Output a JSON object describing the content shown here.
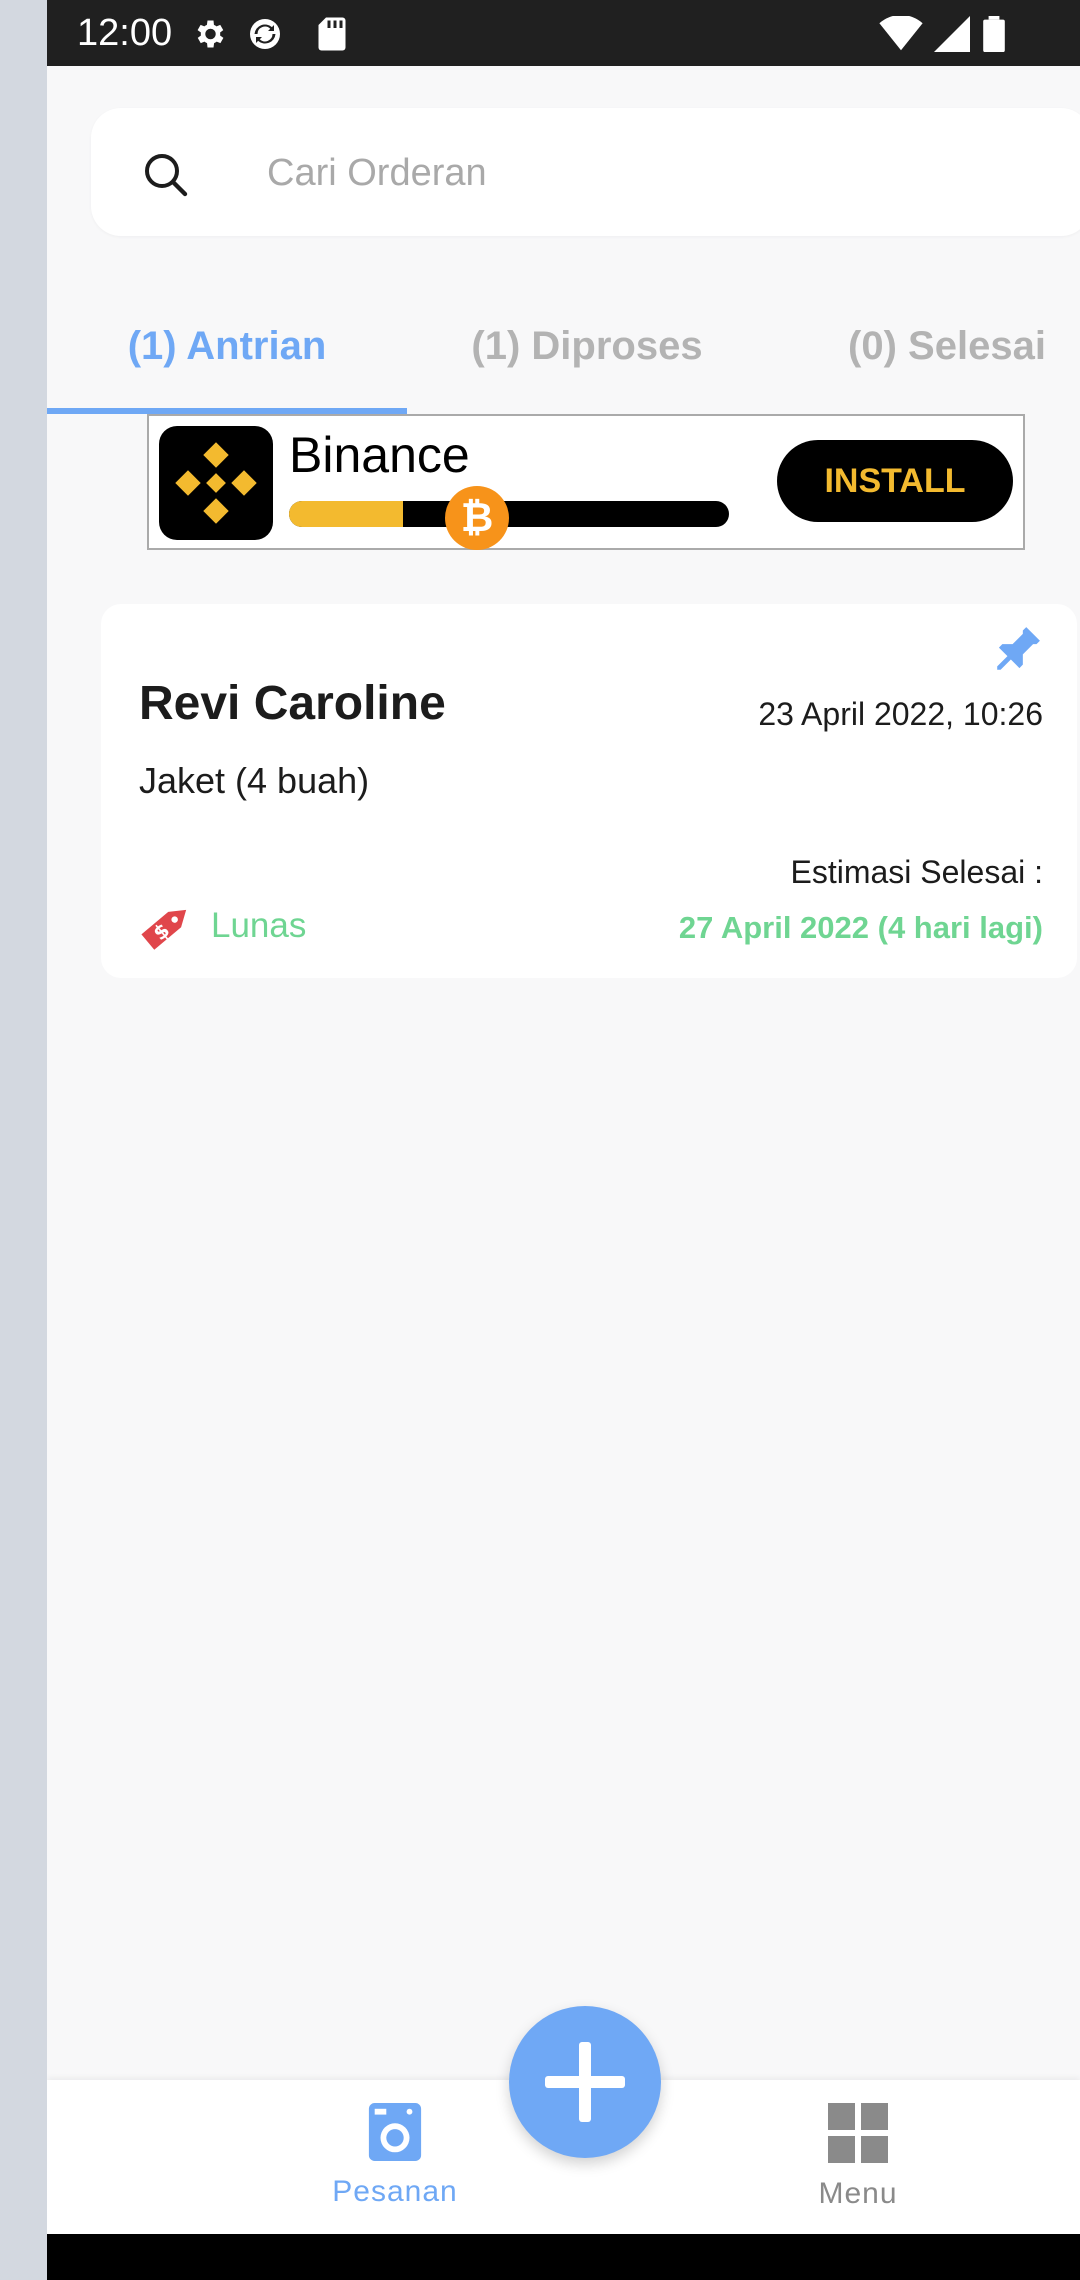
{
  "status_bar": {
    "time": "12:00"
  },
  "search": {
    "placeholder": "Cari Orderan"
  },
  "tabs": [
    {
      "label": "(1) Antrian",
      "active": true
    },
    {
      "label": "(1) Diproses",
      "active": false
    },
    {
      "label": "(0) Selesai",
      "active": false
    }
  ],
  "ad": {
    "title": "Binance",
    "button": "INSTALL",
    "coin_symbol": "₿",
    "progress_fraction": 0.26
  },
  "order": {
    "name": "Revi Caroline",
    "date": "23 April 2022, 10:26",
    "items": "Jaket (4 buah)",
    "estimate_label": "Estimasi Selesai :",
    "payment_status": "Lunas",
    "estimate_date": "27 April 2022 (4 hari lagi)"
  },
  "nav": {
    "orders_label": "Pesanan",
    "menu_label": "Menu"
  },
  "colors": {
    "accent": "#6fa8f5",
    "paid_green": "#6fd592",
    "tag_red": "#e0464b",
    "binance_yellow": "#f3ba2f"
  }
}
